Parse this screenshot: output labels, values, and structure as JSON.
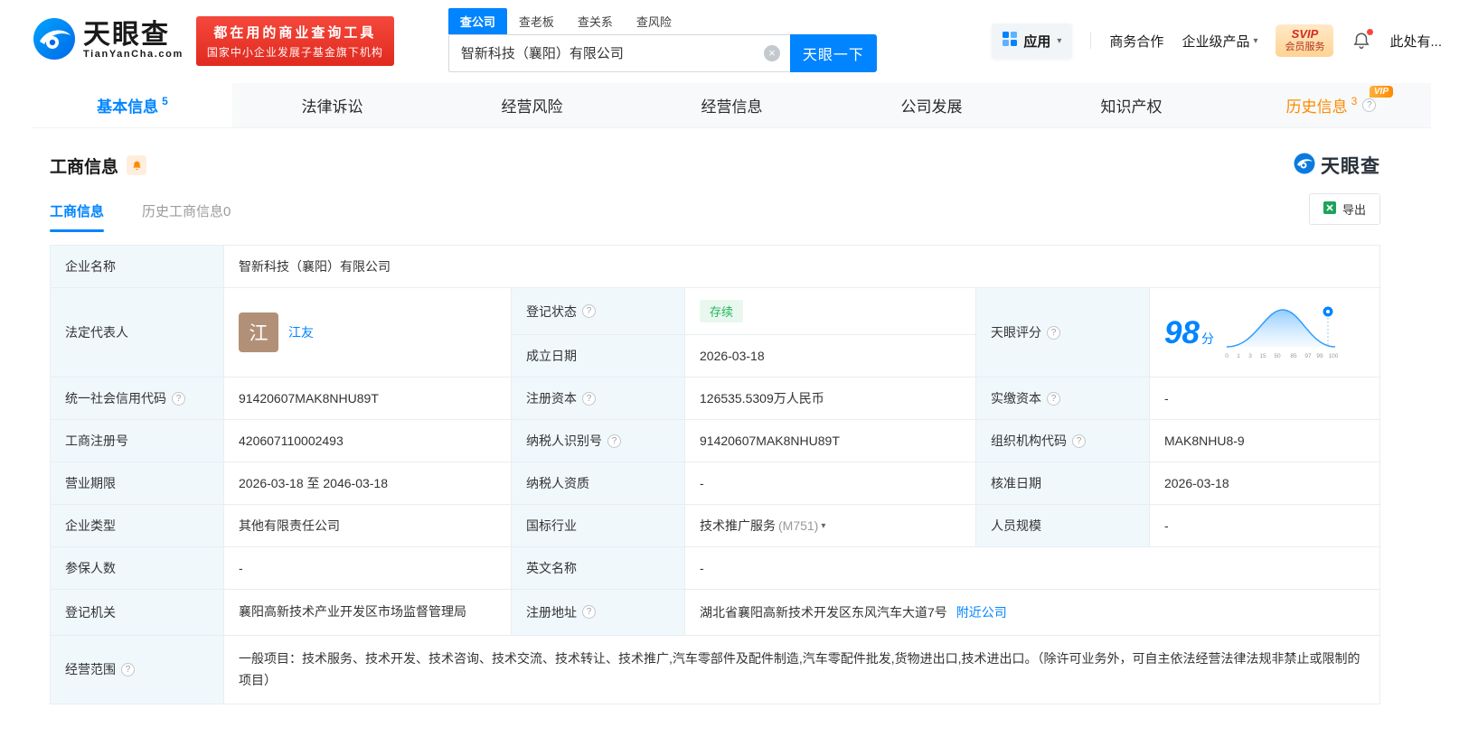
{
  "brand": {
    "name": "天眼查",
    "domain": "TianYanCha.com",
    "accent_color": "#0084ff"
  },
  "header": {
    "banner": {
      "line1": "都在用的商业查询工具",
      "line2": "国家中小企业发展子基金旗下机构"
    },
    "search": {
      "tabs": [
        {
          "label": "查公司"
        },
        {
          "label": "查老板"
        },
        {
          "label": "查关系"
        },
        {
          "label": "查风险"
        }
      ],
      "value": "智新科技（襄阳）有限公司",
      "button_label": "天眼一下"
    },
    "menu": {
      "apps": "应用",
      "cooperation": "商务合作",
      "enterprise_products": "企业级产品",
      "svip_line1": "SVIP",
      "svip_line2": "会员服务",
      "username": "此处有..."
    }
  },
  "nav_tabs": [
    {
      "label": "基本信息",
      "count": "5"
    },
    {
      "label": "法律诉讼",
      "count": ""
    },
    {
      "label": "经营风险",
      "count": ""
    },
    {
      "label": "经营信息",
      "count": ""
    },
    {
      "label": "公司发展",
      "count": ""
    },
    {
      "label": "知识产权",
      "count": ""
    },
    {
      "label": "历史信息",
      "count": "3",
      "vip": "VIP"
    }
  ],
  "section": {
    "title": "工商信息",
    "logo": "天眼查",
    "subtabs": [
      {
        "label": "工商信息"
      },
      {
        "label": "历史工商信息0"
      }
    ],
    "export_label": "导出"
  },
  "fields": {
    "company_name": {
      "label": "企业名称",
      "value": "智新科技（襄阳）有限公司"
    },
    "legal_rep": {
      "label": "法定代表人",
      "value": "江友",
      "avatar_char": "江"
    },
    "reg_status": {
      "label": "登记状态",
      "value": "存续",
      "status_color": "#23b55b"
    },
    "establish_date": {
      "label": "成立日期",
      "value": "2026-03-18"
    },
    "score": {
      "label": "天眼评分",
      "value": "98",
      "unit": "分",
      "axis": [
        "0",
        "1",
        "3",
        "15",
        "50",
        "85",
        "97",
        "99",
        "100"
      ]
    },
    "credit_code": {
      "label": "统一社会信用代码",
      "value": "91420607MAK8NHU89T"
    },
    "reg_capital": {
      "label": "注册资本",
      "value": "126535.5309万人民币"
    },
    "paid_capital": {
      "label": "实缴资本",
      "value": "-"
    },
    "reg_number": {
      "label": "工商注册号",
      "value": "420607110002493"
    },
    "taxpayer_id": {
      "label": "纳税人识别号",
      "value": "91420607MAK8NHU89T"
    },
    "org_code": {
      "label": "组织机构代码",
      "value": "MAK8NHU8-9"
    },
    "business_term": {
      "label": "营业期限",
      "value": "2026-03-18 至 2046-03-18"
    },
    "taxpayer_quality": {
      "label": "纳税人资质",
      "value": "-"
    },
    "approve_date": {
      "label": "核准日期",
      "value": "2026-03-18"
    },
    "company_type": {
      "label": "企业类型",
      "value": "其他有限责任公司"
    },
    "industry": {
      "label": "国标行业",
      "value": "技术推广服务",
      "code": "(M751)"
    },
    "staff_size": {
      "label": "人员规模",
      "value": "-"
    },
    "insured_num": {
      "label": "参保人数",
      "value": "-"
    },
    "english_name": {
      "label": "英文名称",
      "value": "-"
    },
    "reg_authority": {
      "label": "登记机关",
      "value": "襄阳高新技术产业开发区市场监督管理局"
    },
    "reg_address": {
      "label": "注册地址",
      "value": "湖北省襄阳高新技术开发区东风汽车大道7号",
      "link": "附近公司"
    },
    "business_scope": {
      "label": "经营范围",
      "value": "一般项目：技术服务、技术开发、技术咨询、技术交流、技术转让、技术推广,汽车零部件及配件制造,汽车零配件批发,货物进出口,技术进出口。（除许可业务外，可自主依法经营法律法规非禁止或限制的项目）"
    }
  }
}
